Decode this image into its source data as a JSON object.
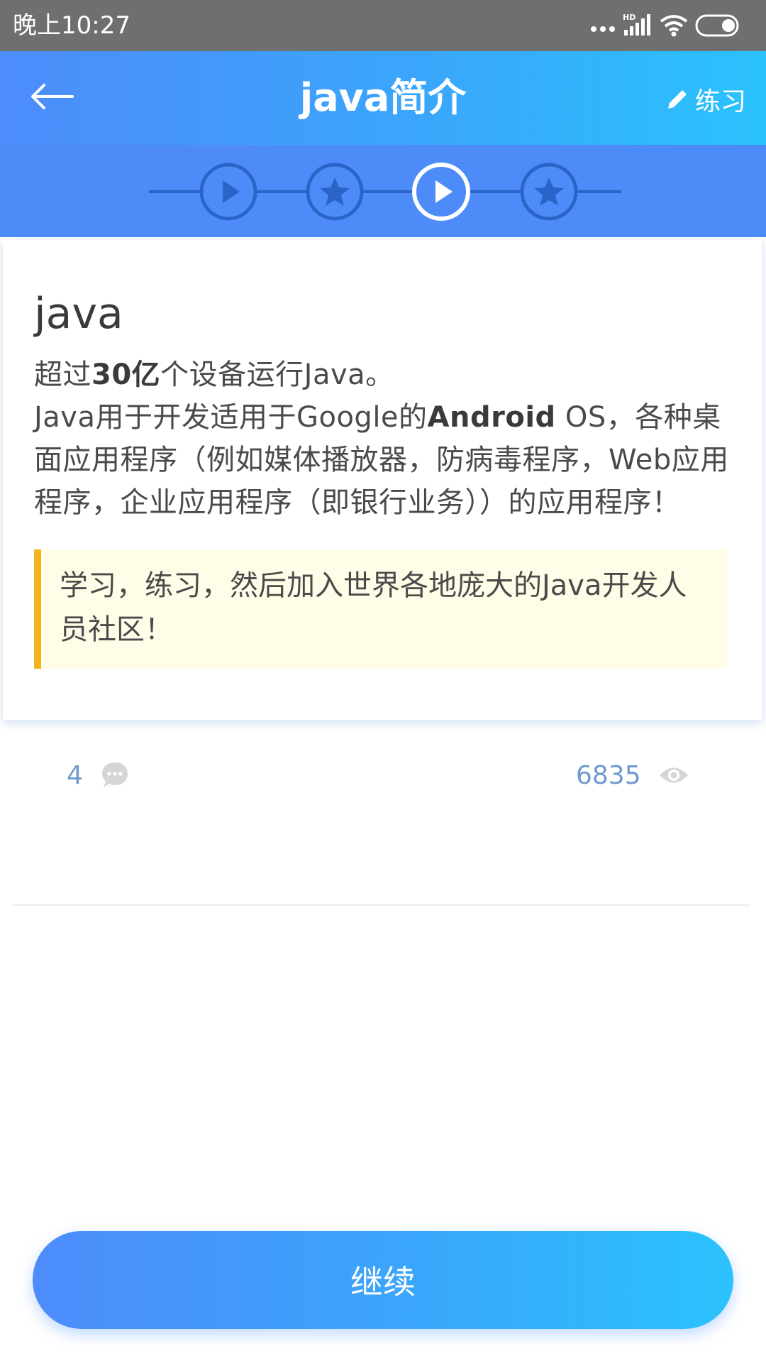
{
  "status_bar": {
    "time": "晚上10:27",
    "icons": [
      "more-dots-icon",
      "hd-signal-icon",
      "wifi-icon",
      "battery-icon"
    ],
    "hd_label": "HD"
  },
  "header": {
    "title": "java简介",
    "practice_label": "练习",
    "back_icon": "arrow-left-icon",
    "practice_icon": "pencil-icon"
  },
  "steps": [
    {
      "type": "play",
      "state": "completed"
    },
    {
      "type": "star",
      "state": "completed"
    },
    {
      "type": "play",
      "state": "current"
    },
    {
      "type": "star",
      "state": "pending"
    }
  ],
  "lesson": {
    "title": "java",
    "line1_before": "超过",
    "line1_bold": "30亿",
    "line1_after": "个设备运行Java。",
    "line2_before": "Java用于开发适用于Google的",
    "line2_bold": "Android",
    "line2_after": " OS，各种桌面应用程序（例如媒体播放器，防病毒程序，Web应用程序，企业应用程序（即银行业务））的应用程序！",
    "tip": "学习，练习，然后加入世界各地庞大的Java开发人员社区！"
  },
  "stats": {
    "comments": "4",
    "views": "6835"
  },
  "continue_label": "继续",
  "colors": {
    "header_gradient_start": "#4d8cfb",
    "header_gradient_end": "#2bc2fd",
    "steps_background": "#4d8cf8",
    "step_inactive": "#2a64c8",
    "tip_background": "#fffde8",
    "tip_border": "#f2b418",
    "stat_text": "#6c9ad0"
  }
}
